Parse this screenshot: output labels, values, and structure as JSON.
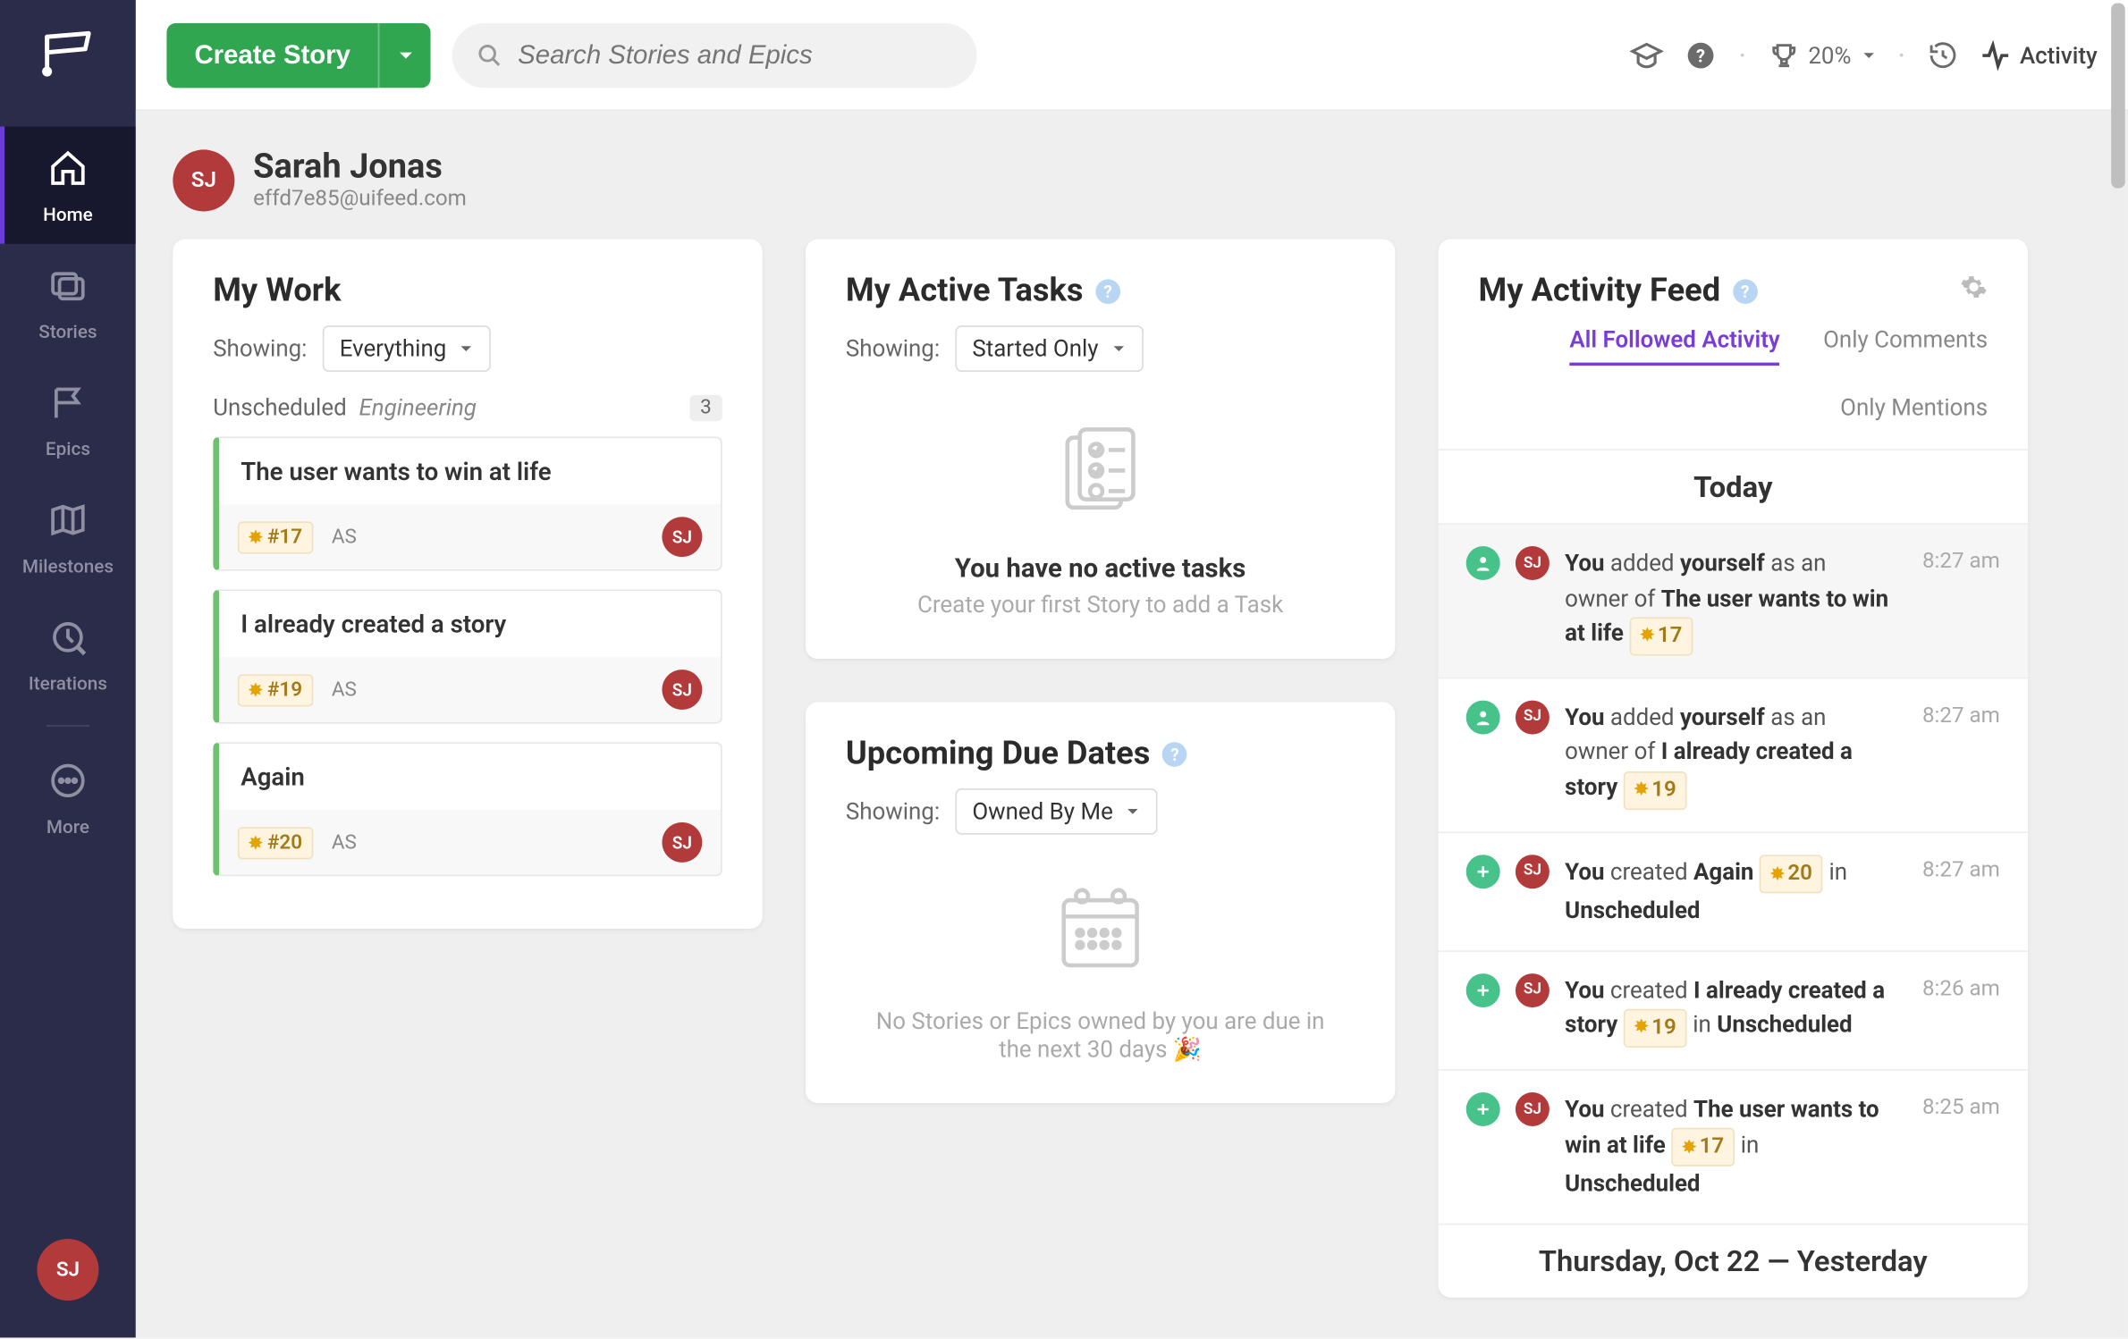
{
  "sidebar": {
    "items": [
      {
        "label": "Home"
      },
      {
        "label": "Stories"
      },
      {
        "label": "Epics"
      },
      {
        "label": "Milestones"
      },
      {
        "label": "Iterations"
      },
      {
        "label": "More"
      }
    ],
    "avatar_initials": "SJ"
  },
  "topbar": {
    "create_label": "Create Story",
    "search_placeholder": "Search Stories and Epics",
    "progress_pct": "20%",
    "activity_label": "Activity"
  },
  "user": {
    "name": "Sarah Jonas",
    "email": "effd7e85@uifeed.com",
    "initials": "SJ"
  },
  "my_work": {
    "title": "My Work",
    "showing_label": "Showing:",
    "filter": "Everything",
    "group_status": "Unscheduled",
    "group_team": "Engineering",
    "group_count": "3",
    "stories": [
      {
        "title": "The user wants to win at life",
        "id": "#17",
        "assignee": "AS",
        "owner": "SJ"
      },
      {
        "title": "I already created a story",
        "id": "#19",
        "assignee": "AS",
        "owner": "SJ"
      },
      {
        "title": "Again",
        "id": "#20",
        "assignee": "AS",
        "owner": "SJ"
      }
    ]
  },
  "my_tasks": {
    "title": "My Active Tasks",
    "showing_label": "Showing:",
    "filter": "Started Only",
    "empty_headline": "You have no active tasks",
    "empty_sub": "Create your first Story to add a Task"
  },
  "due_dates": {
    "title": "Upcoming Due Dates",
    "showing_label": "Showing:",
    "filter": "Owned By Me",
    "empty_line": "No Stories or Epics owned by you are due in the next 30 days 🎉"
  },
  "activity": {
    "title": "My Activity Feed",
    "tabs": [
      "All Followed Activity",
      "Only Comments",
      "Only Mentions"
    ],
    "today_label": "Today",
    "items": [
      {
        "icon": "person",
        "avatar": "SJ",
        "time": "8:27 am",
        "actor": "You",
        "verb": "added",
        "object": "yourself",
        "rest1": "as an owner of",
        "target": "The user wants to win at life",
        "chip": "17",
        "hl": true
      },
      {
        "icon": "person",
        "avatar": "SJ",
        "time": "8:27 am",
        "actor": "You",
        "verb": "added",
        "object": "yourself",
        "rest1": "as an owner of",
        "target": "I already created a story",
        "chip": "19"
      },
      {
        "icon": "plus",
        "avatar": "SJ",
        "time": "8:27 am",
        "actor": "You",
        "verb": "created",
        "target": "Again",
        "chip": "20",
        "rest2": "in",
        "loc": "Unscheduled"
      },
      {
        "icon": "plus",
        "avatar": "SJ",
        "time": "8:26 am",
        "actor": "You",
        "verb": "created",
        "target": "I already created a story",
        "chip": "19",
        "rest2": "in",
        "loc": "Unscheduled"
      },
      {
        "icon": "plus",
        "avatar": "SJ",
        "time": "8:25 am",
        "actor": "You",
        "verb": "created",
        "target": "The user wants to win at life",
        "chip": "17",
        "rest2": "in",
        "loc": "Unscheduled"
      }
    ],
    "prev_day_label": "Thursday, Oct 22   —   Yesterday"
  }
}
